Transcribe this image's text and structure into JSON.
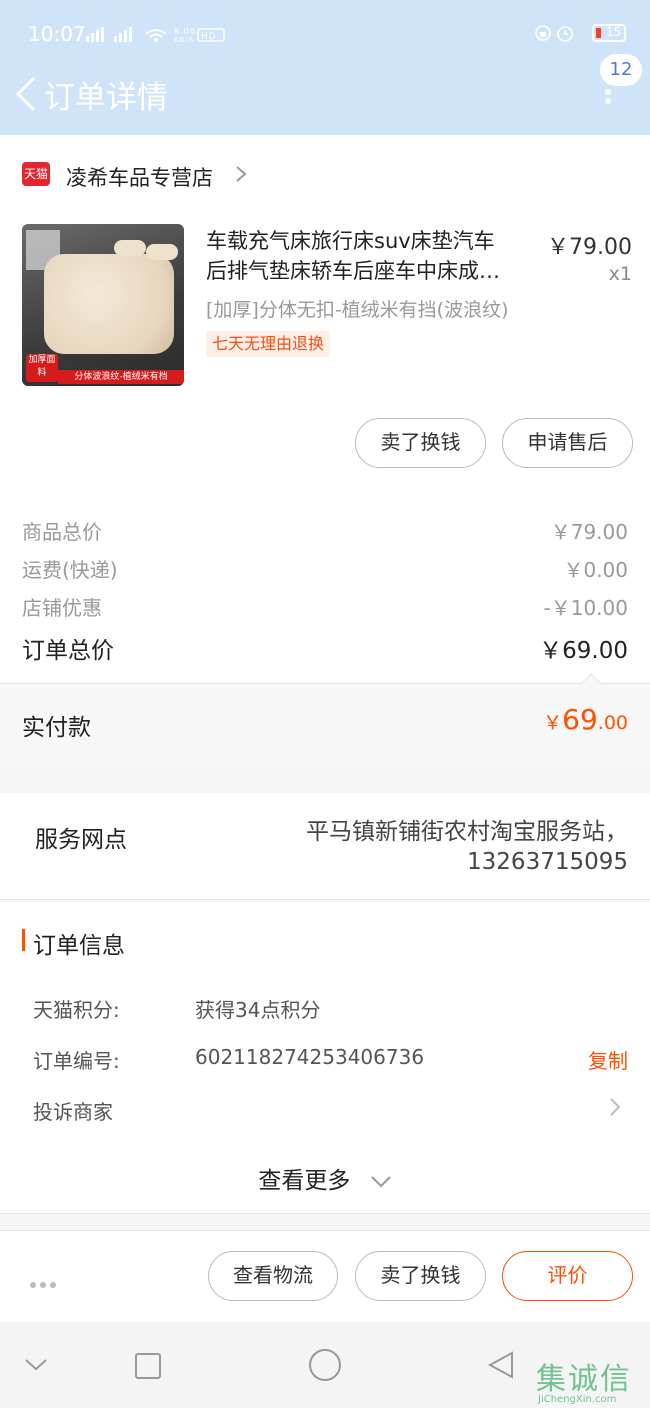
{
  "status_bar": {
    "time": "10:07",
    "indicators": "4G 2G ≋ 8.00 KB/S HD",
    "battery": "15"
  },
  "header": {
    "title": "订单详情",
    "badge_count": "12"
  },
  "shop": {
    "logo_text": "天猫",
    "name": "凌希车品专营店"
  },
  "product": {
    "title_line1": "车载充气床旅行床suv床垫汽车",
    "title_line2": "后排气垫床轿车后座车中床成…",
    "price": "￥79.00",
    "quantity": "x1",
    "sku": "[加厚]分体无扣-植绒米有挡(波浪纹)",
    "refund_tag": "七天无理由退换",
    "image_tag1": "加厚面料",
    "image_tag2": "分体波浪纹-植绒米有档"
  },
  "item_actions": {
    "sell_label": "卖了换钱",
    "after_sale_label": "申请售后"
  },
  "price_summary": {
    "goods_total_label": "商品总价",
    "goods_total_value": "￥79.00",
    "shipping_label": "运费(快递)",
    "shipping_value": "￥0.00",
    "discount_label": "店铺优惠",
    "discount_value": "-￥10.00",
    "order_total_label": "订单总价",
    "order_total_value": "￥69.00",
    "paid_label": "实付款",
    "paid_currency": "￥",
    "paid_integer": "69",
    "paid_decimal": ".00"
  },
  "service": {
    "label": "服务网点",
    "value_line1": "平马镇新铺街农村淘宝服务站，",
    "value_line2": "13263715095"
  },
  "order_info": {
    "title": "订单信息",
    "points_label": "天猫积分:",
    "points_value": "获得34点积分",
    "order_no_label": "订单编号:",
    "order_no_value": "602118274253406736",
    "copy_label": "复制",
    "complaint_label": "投诉商家",
    "see_more_label": "查看更多"
  },
  "bottom_bar": {
    "logistics_label": "查看物流",
    "sell_label": "卖了换钱",
    "review_label": "评价"
  },
  "watermark": {
    "text": "集诚信",
    "sub": "JiChengXin.com"
  },
  "colors": {
    "accent": "#ff5000",
    "header_bg": "#cfe3f9",
    "tmall_red": "#e3262e"
  }
}
